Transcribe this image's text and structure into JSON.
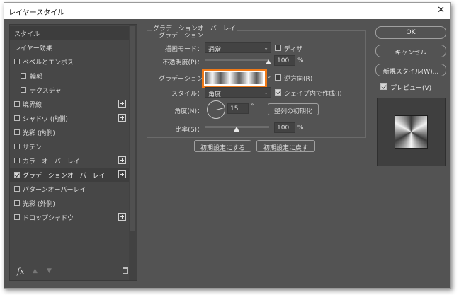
{
  "window": {
    "title": "レイヤースタイル",
    "close": "✕"
  },
  "left": {
    "items": [
      {
        "label": "スタイル"
      },
      {
        "label": "レイヤー効果"
      },
      {
        "label": "ベベルとエンボス"
      },
      {
        "label": "輪郭"
      },
      {
        "label": "テクスチャ"
      },
      {
        "label": "境界線"
      },
      {
        "label": "シャドウ (内側)"
      },
      {
        "label": "光彩 (内側)"
      },
      {
        "label": "サテン"
      },
      {
        "label": "カラーオーバーレイ"
      },
      {
        "label": "グラデーションオーバーレイ"
      },
      {
        "label": "パターンオーバーレイ"
      },
      {
        "label": "光彩 (外側)"
      },
      {
        "label": "ドロップシャドウ"
      }
    ],
    "fx": "fx"
  },
  "panel": {
    "group_title": "グラデーションオーバーレイ",
    "sub_title": "グラデーション",
    "blend_label": "描画モード：",
    "blend_value": "通常",
    "dither_label": "ディザ",
    "opacity_label": "不透明度(P)：",
    "opacity_value": "100",
    "opacity_unit": "%",
    "opacity_level": 1.0,
    "gradient_label": "グラデーション：",
    "reverse_label": "逆方向(R)",
    "style_label": "スタイル：",
    "style_value": "角度",
    "align_label": "シェイプ内で作成(I)",
    "angle_label": "角度(N)：",
    "angle_value": "15",
    "angle_unit": "°",
    "reset_align_label": "整列の初期化",
    "scale_label": "比率(S)：",
    "scale_value": "100",
    "scale_unit": "%",
    "scale_level": 0.5,
    "make_default_label": "初期設定にする",
    "reset_default_label": "初期設定に戻す"
  },
  "right": {
    "ok_label": "OK",
    "cancel_label": "キャンセル",
    "new_style_label": "新規スタイル(W)...",
    "preview_label": "プレビュー(V)"
  },
  "colors": {
    "accent": "#f07a18",
    "panel_bg": "#535353"
  }
}
